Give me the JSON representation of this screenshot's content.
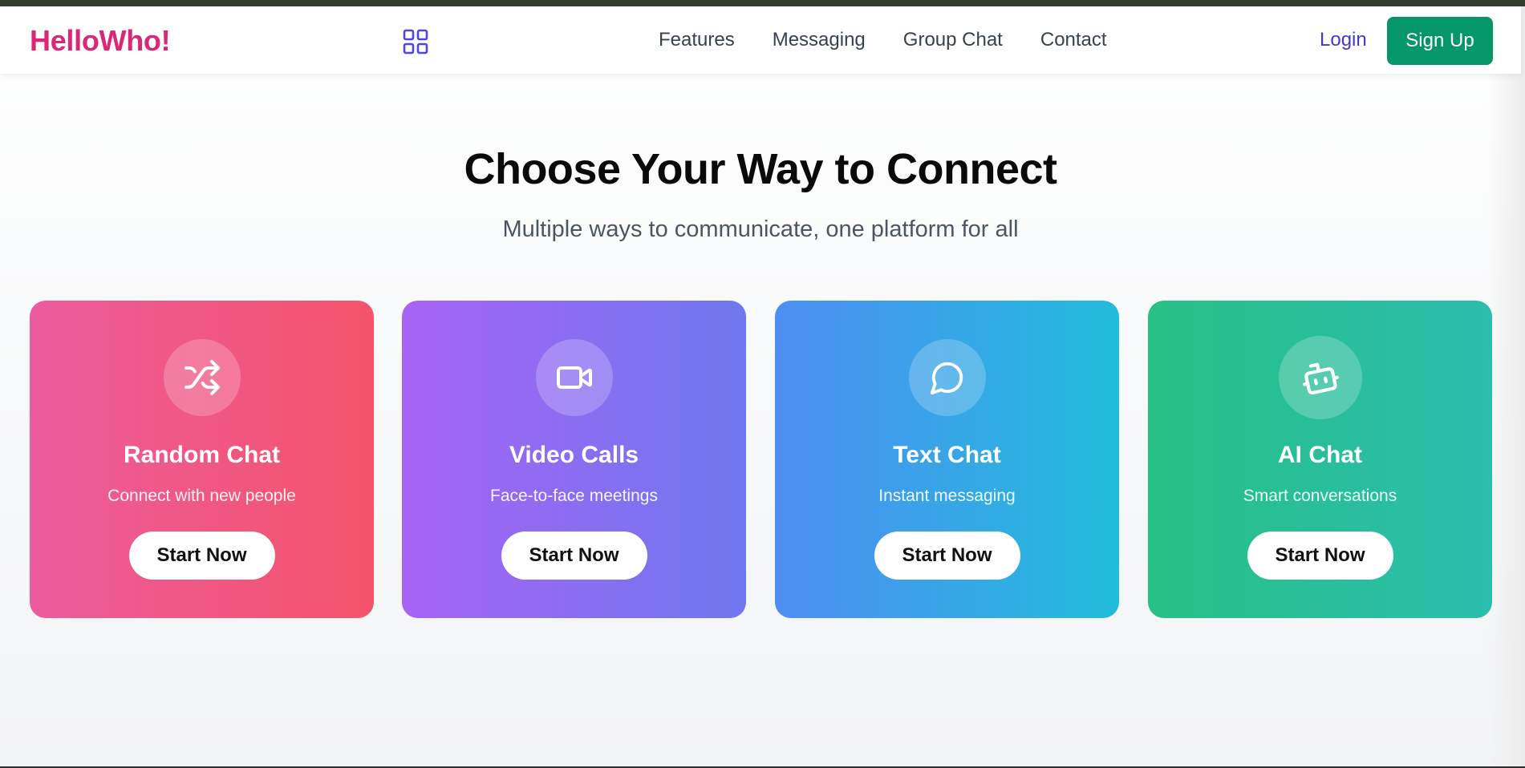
{
  "nav": {
    "logo": "HelloWho!",
    "links": [
      "Features",
      "Messaging",
      "Group Chat",
      "Contact"
    ],
    "login": "Login",
    "signup": "Sign Up"
  },
  "hero": {
    "title": "Choose Your Way to Connect",
    "subtitle": "Multiple ways to communicate, one platform for all"
  },
  "cards": [
    {
      "icon": "shuffle-icon",
      "title": "Random Chat",
      "description": "Connect with new people",
      "button": "Start Now"
    },
    {
      "icon": "video-camera-icon",
      "title": "Video Calls",
      "description": "Face-to-face meetings",
      "button": "Start Now"
    },
    {
      "icon": "chat-bubble-icon",
      "title": "Text Chat",
      "description": "Instant messaging",
      "button": "Start Now"
    },
    {
      "icon": "robot-icon",
      "title": "AI Chat",
      "description": "Smart conversations",
      "button": "Start Now"
    }
  ],
  "colors": {
    "logo": "#db2777",
    "signup": "#059669",
    "login": "#4338ca"
  }
}
